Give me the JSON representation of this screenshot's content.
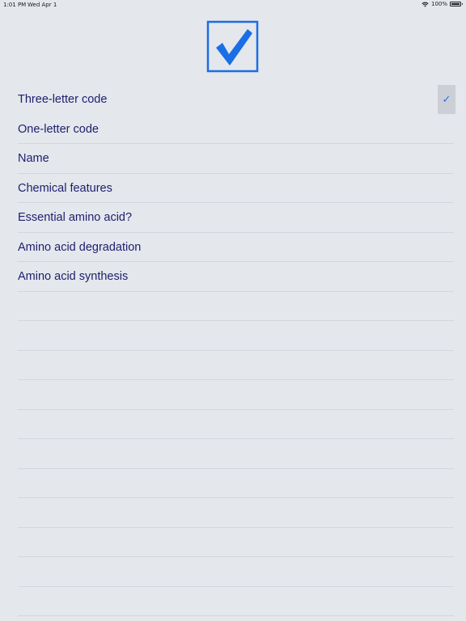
{
  "status_bar": {
    "time": "1:01 PM",
    "date": "Wed Apr 1",
    "battery_percent": "100%",
    "battery_level": 1.0,
    "wifi_icon": "wifi-icon",
    "battery_icon": "battery-icon"
  },
  "header": {
    "logo_icon": "checkbox-checked-icon",
    "accent_color": "#1a6ee6"
  },
  "options": [
    {
      "label": "Three-letter code",
      "checked": true
    },
    {
      "label": "One-letter code",
      "checked": false
    },
    {
      "label": "Name",
      "checked": false
    },
    {
      "label": "Chemical features",
      "checked": false
    },
    {
      "label": "Essential amino acid?",
      "checked": false
    },
    {
      "label": "Amino acid degradation",
      "checked": false
    },
    {
      "label": "Amino acid synthesis",
      "checked": false
    }
  ],
  "colors": {
    "background": "#e4e7ec",
    "text": "#1e1e6e",
    "check": "#2f6fe0"
  }
}
